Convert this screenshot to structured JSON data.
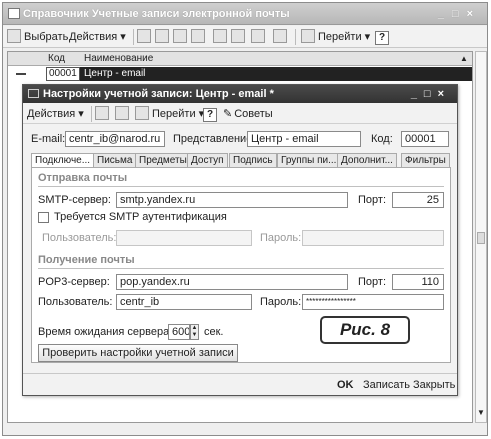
{
  "outer": {
    "title": "Справочник Учетные записи электронной почты",
    "toolbar": {
      "select_label": "Выбрать",
      "actions_label": "Действия ▾",
      "goto_label": "Перейти ▾",
      "help_label": "?"
    },
    "grid": {
      "columns": [
        "Код",
        "Наименование"
      ],
      "rows": [
        {
          "code": "00001",
          "name": "Центр - email"
        }
      ]
    }
  },
  "dialog": {
    "title": "Настройки учетной записи: Центр - email *",
    "toolbar": {
      "actions_label": "Действия ▾",
      "goto_label": "Перейти ▾",
      "help_label": "?",
      "tips_label": "Советы"
    },
    "header": {
      "email_label": "E-mail:",
      "email_value": "centr_ib@narod.ru",
      "view_label": "Представление:",
      "view_value": "Центр - email",
      "code_label": "Код:",
      "code_value": "00001"
    },
    "tabs": [
      "Подключе...",
      "Письма",
      "Предметы",
      "Доступ",
      "Подпись",
      "Группы пи...",
      "Дополнит...",
      "Фильтры"
    ],
    "smtp": {
      "section_title": "Отправка почты",
      "server_label": "SMTP-сервер:",
      "server_value": "smtp.yandex.ru",
      "port_label": "Порт:",
      "port_value": "25",
      "auth_label": "Требуется SMTP аутентификация",
      "user_label": "Пользователь:",
      "password_label": "Пароль:"
    },
    "pop3": {
      "section_title": "Получение почты",
      "server_label": "POP3-сервер:",
      "server_value": "pop.yandex.ru",
      "port_label": "Порт:",
      "port_value": "110",
      "user_label": "Пользователь:",
      "user_value": "centr_ib",
      "password_label": "Пароль:",
      "password_value": "****************"
    },
    "timeout": {
      "label": "Время ожидания сервера:",
      "value": "600",
      "unit": "сек."
    },
    "check_button": "Проверить настройки учетной записи",
    "footer": {
      "ok": "OK",
      "save": "Записать",
      "close": "Закрыть"
    }
  },
  "caption": "Рис. 8"
}
